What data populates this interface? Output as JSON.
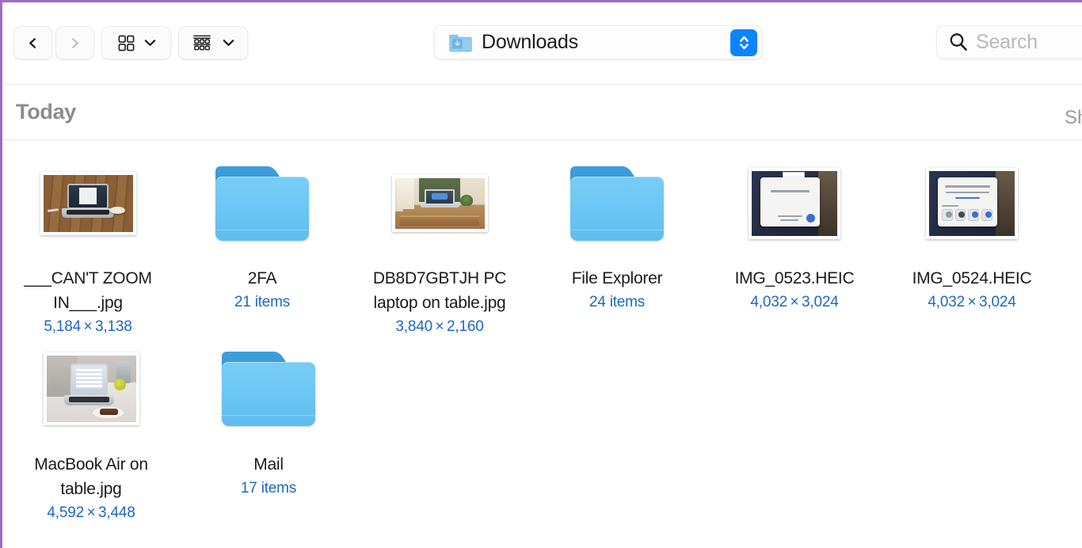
{
  "window": {
    "accent_border_color": "#9a6cc4"
  },
  "toolbar": {
    "back_label": "Back",
    "forward_label": "Forward",
    "view_mode_label": "Icon View",
    "group_mode_label": "Group By",
    "path": {
      "label": "Downloads",
      "icon": "downloads-folder-icon"
    },
    "search": {
      "placeholder": "Search",
      "value": "",
      "icon": "search-icon"
    }
  },
  "group": {
    "title": "Today",
    "action_label": "Sh"
  },
  "colors": {
    "folder_body": "#6cc6f3",
    "folder_tab": "#3f9fdc",
    "meta_text": "#1d68c0",
    "name_text": "#1b1b1b",
    "group_title": "#8c8c8c"
  },
  "files": [
    {
      "name": "___CAN'T ZOOM IN___.jpg",
      "meta": "5,184 × 3,138",
      "kind": "image",
      "scene": "wood",
      "thumb_w": 113,
      "thumb_h": 72
    },
    {
      "name": "2FA",
      "meta": "21 items",
      "kind": "folder",
      "scene": "",
      "thumb_w": 0,
      "thumb_h": 0
    },
    {
      "name": "DB8D7GBTJH PC laptop on table.jpg",
      "meta": "3,840 × 2,160",
      "kind": "image",
      "scene": "desk",
      "thumb_w": 113,
      "thumb_h": 64
    },
    {
      "name": "File Explorer",
      "meta": "24 items",
      "kind": "folder",
      "scene": "",
      "thumb_w": 0,
      "thumb_h": 0
    },
    {
      "name": "IMG_0523.HEIC",
      "meta": "4,032 × 3,024",
      "kind": "image",
      "scene": "ipad1",
      "thumb_w": 108,
      "thumb_h": 82
    },
    {
      "name": "IMG_0524.HEIC",
      "meta": "4,032 × 3,024",
      "kind": "image",
      "scene": "ipad2",
      "thumb_w": 108,
      "thumb_h": 82
    },
    {
      "name": "MacBook Air on table.jpg",
      "meta": "4,592 × 3,448",
      "kind": "image",
      "scene": "air",
      "thumb_w": 113,
      "thumb_h": 84
    },
    {
      "name": "Mail",
      "meta": "17 items",
      "kind": "folder",
      "scene": "",
      "thumb_w": 0,
      "thumb_h": 0
    }
  ]
}
